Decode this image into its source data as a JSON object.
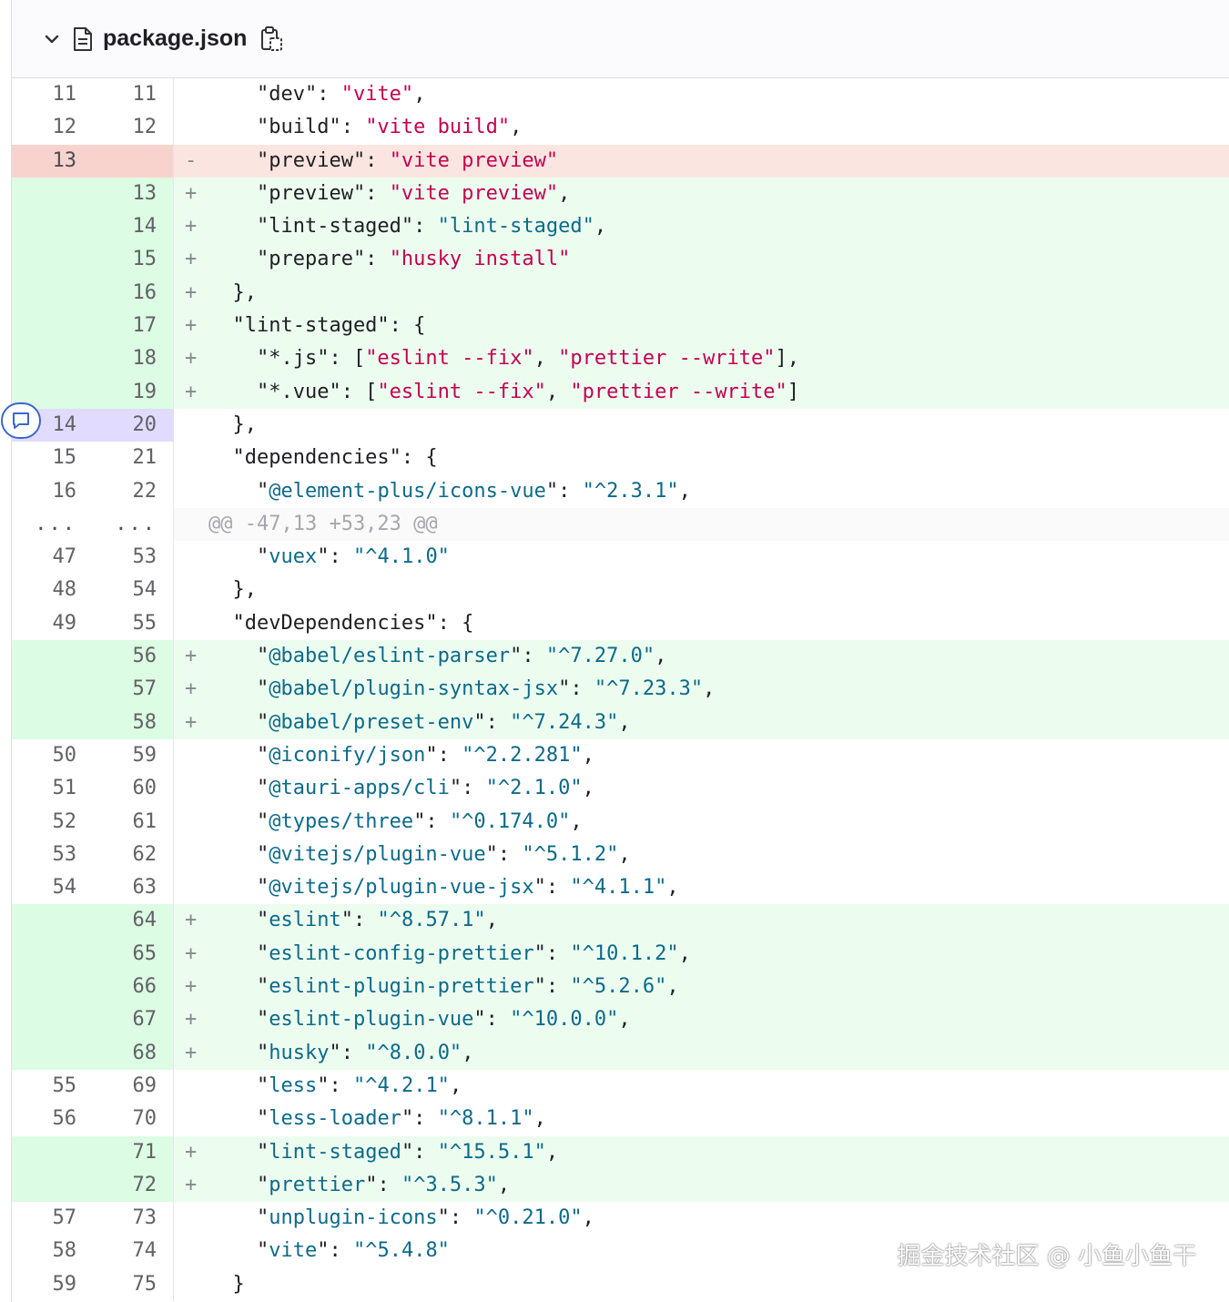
{
  "file": {
    "name": "package.json"
  },
  "watermark": "掘金技术社区 @ 小鱼小鱼干",
  "hunk_header": "@@ -47,13 +53,23 @@",
  "ellipsis": "...",
  "lines": [
    {
      "type": "ctx",
      "old": "11",
      "new": "11",
      "sign": "",
      "segs": [
        [
          "p",
          "    \"dev\": "
        ],
        [
          "s",
          "\"vite\""
        ],
        [
          "p",
          ","
        ]
      ]
    },
    {
      "type": "ctx",
      "old": "12",
      "new": "12",
      "sign": "",
      "segs": [
        [
          "p",
          "    \"build\": "
        ],
        [
          "s",
          "\"vite build\""
        ],
        [
          "p",
          ","
        ]
      ]
    },
    {
      "type": "del",
      "old": "13",
      "new": "",
      "sign": "-",
      "segs": [
        [
          "p",
          "    \"preview\": "
        ],
        [
          "s",
          "\"vite preview\""
        ]
      ]
    },
    {
      "type": "add",
      "old": "",
      "new": "13",
      "sign": "+",
      "segs": [
        [
          "p",
          "    \"preview\": "
        ],
        [
          "s",
          "\"vite preview\""
        ],
        [
          "p",
          ","
        ]
      ]
    },
    {
      "type": "add",
      "old": "",
      "new": "14",
      "sign": "+",
      "segs": [
        [
          "p",
          "    \"lint-staged\": "
        ],
        [
          "k",
          "\"lint-staged\""
        ],
        [
          "p",
          ","
        ]
      ]
    },
    {
      "type": "add",
      "old": "",
      "new": "15",
      "sign": "+",
      "segs": [
        [
          "p",
          "    \"prepare\": "
        ],
        [
          "s",
          "\"husky install\""
        ]
      ]
    },
    {
      "type": "add",
      "old": "",
      "new": "16",
      "sign": "+",
      "segs": [
        [
          "p",
          "  },"
        ]
      ]
    },
    {
      "type": "add",
      "old": "",
      "new": "17",
      "sign": "+",
      "segs": [
        [
          "p",
          "  \"lint-staged\": {"
        ]
      ]
    },
    {
      "type": "add",
      "old": "",
      "new": "18",
      "sign": "+",
      "segs": [
        [
          "p",
          "    \"*.js\": ["
        ],
        [
          "s",
          "\"eslint --fix\""
        ],
        [
          "p",
          ", "
        ],
        [
          "s",
          "\"prettier --write\""
        ],
        [
          "p",
          "],"
        ]
      ]
    },
    {
      "type": "add",
      "old": "",
      "new": "19",
      "sign": "+",
      "segs": [
        [
          "p",
          "    \"*.vue\": ["
        ],
        [
          "s",
          "\"eslint --fix\""
        ],
        [
          "p",
          ", "
        ],
        [
          "s",
          "\"prettier --write\""
        ],
        [
          "p",
          "]"
        ]
      ]
    },
    {
      "type": "sel",
      "old": "14",
      "new": "20",
      "sign": "",
      "segs": [
        [
          "p",
          "  },"
        ]
      ]
    },
    {
      "type": "ctx",
      "old": "15",
      "new": "21",
      "sign": "",
      "segs": [
        [
          "p",
          "  \"dependencies\": {"
        ]
      ]
    },
    {
      "type": "ctx",
      "old": "16",
      "new": "22",
      "sign": "",
      "segs": [
        [
          "p",
          "    \""
        ],
        [
          "k",
          "@element-plus/icons-vue"
        ],
        [
          "p",
          "\": "
        ],
        [
          "k",
          "\"^2.3.1\""
        ],
        [
          "p",
          ","
        ]
      ]
    },
    {
      "type": "hunk",
      "old": "...",
      "new": "...",
      "sign": "",
      "segs": [
        [
          "h",
          "@@ -47,13 +53,23 @@"
        ]
      ]
    },
    {
      "type": "ctx",
      "old": "47",
      "new": "53",
      "sign": "",
      "segs": [
        [
          "p",
          "    \""
        ],
        [
          "k",
          "vuex"
        ],
        [
          "p",
          "\": "
        ],
        [
          "k",
          "\"^4.1.0\""
        ]
      ]
    },
    {
      "type": "ctx",
      "old": "48",
      "new": "54",
      "sign": "",
      "segs": [
        [
          "p",
          "  },"
        ]
      ]
    },
    {
      "type": "ctx",
      "old": "49",
      "new": "55",
      "sign": "",
      "segs": [
        [
          "p",
          "  \"devDependencies\": {"
        ]
      ]
    },
    {
      "type": "add",
      "old": "",
      "new": "56",
      "sign": "+",
      "segs": [
        [
          "p",
          "    \""
        ],
        [
          "k",
          "@babel/eslint-parser"
        ],
        [
          "p",
          "\": "
        ],
        [
          "k",
          "\"^7.27.0\""
        ],
        [
          "p",
          ","
        ]
      ]
    },
    {
      "type": "add",
      "old": "",
      "new": "57",
      "sign": "+",
      "segs": [
        [
          "p",
          "    \""
        ],
        [
          "k",
          "@babel/plugin-syntax-jsx"
        ],
        [
          "p",
          "\": "
        ],
        [
          "k",
          "\"^7.23.3\""
        ],
        [
          "p",
          ","
        ]
      ]
    },
    {
      "type": "add",
      "old": "",
      "new": "58",
      "sign": "+",
      "segs": [
        [
          "p",
          "    \""
        ],
        [
          "k",
          "@babel/preset-env"
        ],
        [
          "p",
          "\": "
        ],
        [
          "k",
          "\"^7.24.3\""
        ],
        [
          "p",
          ","
        ]
      ]
    },
    {
      "type": "ctx",
      "old": "50",
      "new": "59",
      "sign": "",
      "segs": [
        [
          "p",
          "    \""
        ],
        [
          "k",
          "@iconify/json"
        ],
        [
          "p",
          "\": "
        ],
        [
          "k",
          "\"^2.2.281\""
        ],
        [
          "p",
          ","
        ]
      ]
    },
    {
      "type": "ctx",
      "old": "51",
      "new": "60",
      "sign": "",
      "segs": [
        [
          "p",
          "    \""
        ],
        [
          "k",
          "@tauri-apps/cli"
        ],
        [
          "p",
          "\": "
        ],
        [
          "k",
          "\"^2.1.0\""
        ],
        [
          "p",
          ","
        ]
      ]
    },
    {
      "type": "ctx",
      "old": "52",
      "new": "61",
      "sign": "",
      "segs": [
        [
          "p",
          "    \""
        ],
        [
          "k",
          "@types/three"
        ],
        [
          "p",
          "\": "
        ],
        [
          "k",
          "\"^0.174.0\""
        ],
        [
          "p",
          ","
        ]
      ]
    },
    {
      "type": "ctx",
      "old": "53",
      "new": "62",
      "sign": "",
      "segs": [
        [
          "p",
          "    \""
        ],
        [
          "k",
          "@vitejs/plugin-vue"
        ],
        [
          "p",
          "\": "
        ],
        [
          "k",
          "\"^5.1.2\""
        ],
        [
          "p",
          ","
        ]
      ]
    },
    {
      "type": "ctx",
      "old": "54",
      "new": "63",
      "sign": "",
      "segs": [
        [
          "p",
          "    \""
        ],
        [
          "k",
          "@vitejs/plugin-vue-jsx"
        ],
        [
          "p",
          "\": "
        ],
        [
          "k",
          "\"^4.1.1\""
        ],
        [
          "p",
          ","
        ]
      ]
    },
    {
      "type": "add",
      "old": "",
      "new": "64",
      "sign": "+",
      "segs": [
        [
          "p",
          "    \""
        ],
        [
          "k",
          "eslint"
        ],
        [
          "p",
          "\": "
        ],
        [
          "k",
          "\"^8.57.1\""
        ],
        [
          "p",
          ","
        ]
      ]
    },
    {
      "type": "add",
      "old": "",
      "new": "65",
      "sign": "+",
      "segs": [
        [
          "p",
          "    \""
        ],
        [
          "k",
          "eslint-config-prettier"
        ],
        [
          "p",
          "\": "
        ],
        [
          "k",
          "\"^10.1.2\""
        ],
        [
          "p",
          ","
        ]
      ]
    },
    {
      "type": "add",
      "old": "",
      "new": "66",
      "sign": "+",
      "segs": [
        [
          "p",
          "    \""
        ],
        [
          "k",
          "eslint-plugin-prettier"
        ],
        [
          "p",
          "\": "
        ],
        [
          "k",
          "\"^5.2.6\""
        ],
        [
          "p",
          ","
        ]
      ]
    },
    {
      "type": "add",
      "old": "",
      "new": "67",
      "sign": "+",
      "segs": [
        [
          "p",
          "    \""
        ],
        [
          "k",
          "eslint-plugin-vue"
        ],
        [
          "p",
          "\": "
        ],
        [
          "k",
          "\"^10.0.0\""
        ],
        [
          "p",
          ","
        ]
      ]
    },
    {
      "type": "add",
      "old": "",
      "new": "68",
      "sign": "+",
      "segs": [
        [
          "p",
          "    \""
        ],
        [
          "k",
          "husky"
        ],
        [
          "p",
          "\": "
        ],
        [
          "k",
          "\"^8.0.0\""
        ],
        [
          "p",
          ","
        ]
      ]
    },
    {
      "type": "ctx",
      "old": "55",
      "new": "69",
      "sign": "",
      "segs": [
        [
          "p",
          "    \""
        ],
        [
          "k",
          "less"
        ],
        [
          "p",
          "\": "
        ],
        [
          "k",
          "\"^4.2.1\""
        ],
        [
          "p",
          ","
        ]
      ]
    },
    {
      "type": "ctx",
      "old": "56",
      "new": "70",
      "sign": "",
      "segs": [
        [
          "p",
          "    \""
        ],
        [
          "k",
          "less-loader"
        ],
        [
          "p",
          "\": "
        ],
        [
          "k",
          "\"^8.1.1\""
        ],
        [
          "p",
          ","
        ]
      ]
    },
    {
      "type": "add",
      "old": "",
      "new": "71",
      "sign": "+",
      "segs": [
        [
          "p",
          "    \""
        ],
        [
          "k",
          "lint-staged"
        ],
        [
          "p",
          "\": "
        ],
        [
          "k",
          "\"^15.5.1\""
        ],
        [
          "p",
          ","
        ]
      ]
    },
    {
      "type": "add",
      "old": "",
      "new": "72",
      "sign": "+",
      "segs": [
        [
          "p",
          "    \""
        ],
        [
          "k",
          "prettier"
        ],
        [
          "p",
          "\": "
        ],
        [
          "k",
          "\"^3.5.3\""
        ],
        [
          "p",
          ","
        ]
      ]
    },
    {
      "type": "ctx",
      "old": "57",
      "new": "73",
      "sign": "",
      "segs": [
        [
          "p",
          "    \""
        ],
        [
          "k",
          "unplugin-icons"
        ],
        [
          "p",
          "\": "
        ],
        [
          "k",
          "\"^0.21.0\""
        ],
        [
          "p",
          ","
        ]
      ]
    },
    {
      "type": "ctx",
      "old": "58",
      "new": "74",
      "sign": "",
      "segs": [
        [
          "p",
          "    \""
        ],
        [
          "k",
          "vite"
        ],
        [
          "p",
          "\": "
        ],
        [
          "k",
          "\"^5.4.8\""
        ]
      ]
    },
    {
      "type": "ctx",
      "old": "59",
      "new": "75",
      "sign": "",
      "segs": [
        [
          "p",
          "  }"
        ]
      ]
    }
  ]
}
